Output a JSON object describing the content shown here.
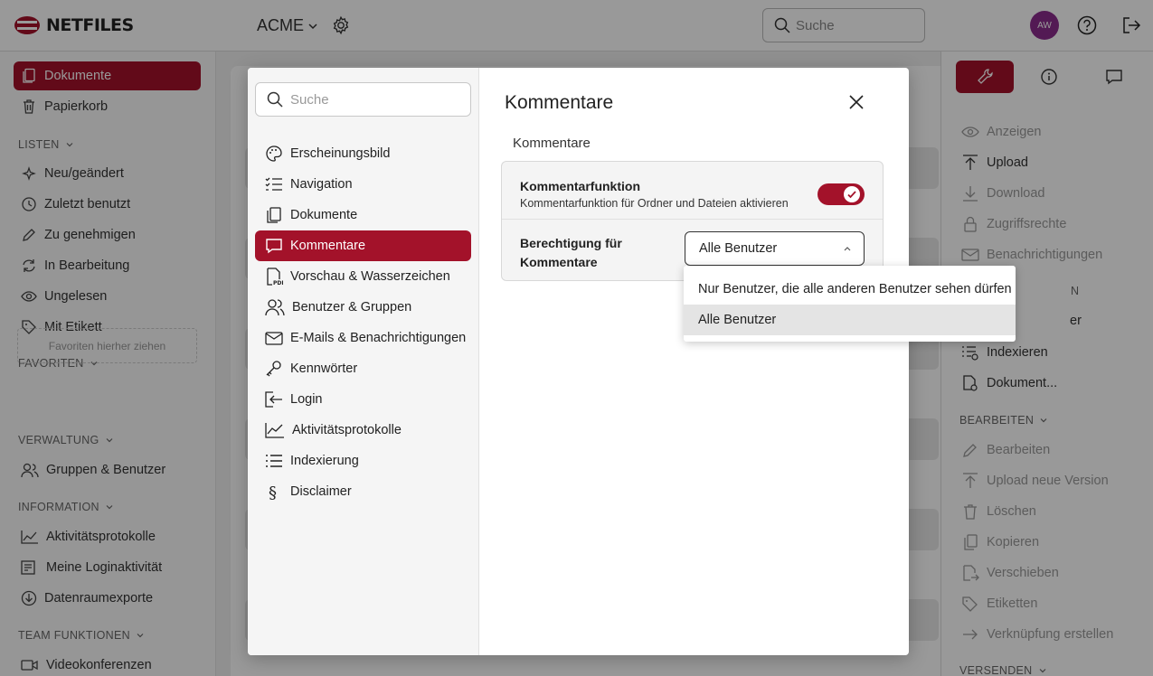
{
  "topbar": {
    "logo_text": "NETFILES",
    "workspace": "ACME",
    "search_placeholder": "Suche",
    "avatar_initials": "AW"
  },
  "sidebar": {
    "items_top": [
      {
        "label": "Dokumente",
        "icon": "documents-icon"
      },
      {
        "label": "Papierkorb",
        "icon": "trash-icon"
      }
    ],
    "section_lists": "LISTEN",
    "lists": [
      {
        "label": "Neu/geändert",
        "icon": "sparkle-icon"
      },
      {
        "label": "Zuletzt benutzt",
        "icon": "clock-icon"
      },
      {
        "label": "Zu genehmigen",
        "icon": "pencil-icon"
      },
      {
        "label": "In Bearbeitung",
        "icon": "sync-icon"
      },
      {
        "label": "Ungelesen",
        "icon": "eye-icon"
      },
      {
        "label": "Mit Etikett",
        "icon": "tag-icon"
      }
    ],
    "section_favorites": "FAVORITEN",
    "favorites_drop": "Favoriten hierher ziehen",
    "section_admin": "VERWALTUNG",
    "admin": [
      {
        "label": "Gruppen & Benutzer",
        "icon": "users-icon"
      }
    ],
    "section_info": "INFORMATION",
    "info": [
      {
        "label": "Aktivitätsprotokolle",
        "icon": "activity-icon"
      },
      {
        "label": "Meine Loginaktivität",
        "icon": "login-list-icon"
      },
      {
        "label": "Datenraumexporte",
        "icon": "download-circle-icon"
      }
    ],
    "section_team": "TEAM FUNKTIONEN",
    "team": [
      {
        "label": "Videokonferenzen",
        "icon": "video-icon"
      }
    ]
  },
  "rightpanel": {
    "items": [
      {
        "label": "Anzeigen",
        "enabled": false
      },
      {
        "label": "Upload",
        "enabled": true
      },
      {
        "label": "Download",
        "enabled": false
      },
      {
        "label": "Zugriffsrechte",
        "enabled": false
      },
      {
        "label": "Benachrichtigungen",
        "enabled": false
      }
    ],
    "partial_section": "N",
    "partial_item": "er",
    "items2": [
      {
        "label": "Indexieren",
        "enabled": true
      },
      {
        "label": "Dokument...",
        "enabled": true
      }
    ],
    "section_edit": "BEARBEITEN",
    "edit_items": [
      {
        "label": "Bearbeiten"
      },
      {
        "label": "Upload neue Version"
      },
      {
        "label": "Löschen"
      },
      {
        "label": "Kopieren"
      },
      {
        "label": "Verschieben"
      },
      {
        "label": "Etiketten"
      },
      {
        "label": "Verknüpfung erstellen"
      }
    ],
    "section_send": "VERSENDEN"
  },
  "modal": {
    "search_placeholder": "Suche",
    "nav": [
      {
        "label": "Erscheinungsbild",
        "icon": "palette-icon"
      },
      {
        "label": "Navigation",
        "icon": "checklist-icon"
      },
      {
        "label": "Dokumente",
        "icon": "documents-icon"
      },
      {
        "label": "Kommentare",
        "icon": "comment-icon",
        "active": true
      },
      {
        "label": "Vorschau & Wasserzeichen",
        "icon": "pdf-icon"
      },
      {
        "label": "Benutzer & Gruppen",
        "icon": "users-icon"
      },
      {
        "label": "E-Mails & Benachrichtigungen",
        "icon": "mail-icon"
      },
      {
        "label": "Kennwörter",
        "icon": "key-icon"
      },
      {
        "label": "Login",
        "icon": "login-icon"
      },
      {
        "label": "Aktivitätsprotokolle",
        "icon": "activity-icon"
      },
      {
        "label": "Indexierung",
        "icon": "list-icon"
      },
      {
        "label": "Disclaimer",
        "icon": "paragraph-icon"
      }
    ],
    "title": "Kommentare",
    "subtitle": "Kommentare",
    "setting_comment_title": "Kommentarfunktion",
    "setting_comment_desc": "Kommentarfunktion für Ordner und Dateien aktivieren",
    "setting_comment_enabled": true,
    "permission_label": "Berechtigung für Kommentare",
    "permission_value": "Alle Benutzer",
    "permission_options": [
      "Nur Benutzer, die alle anderen Benutzer sehen dürfen",
      "Alle Benutzer"
    ],
    "accent_color": "#a3122a"
  }
}
